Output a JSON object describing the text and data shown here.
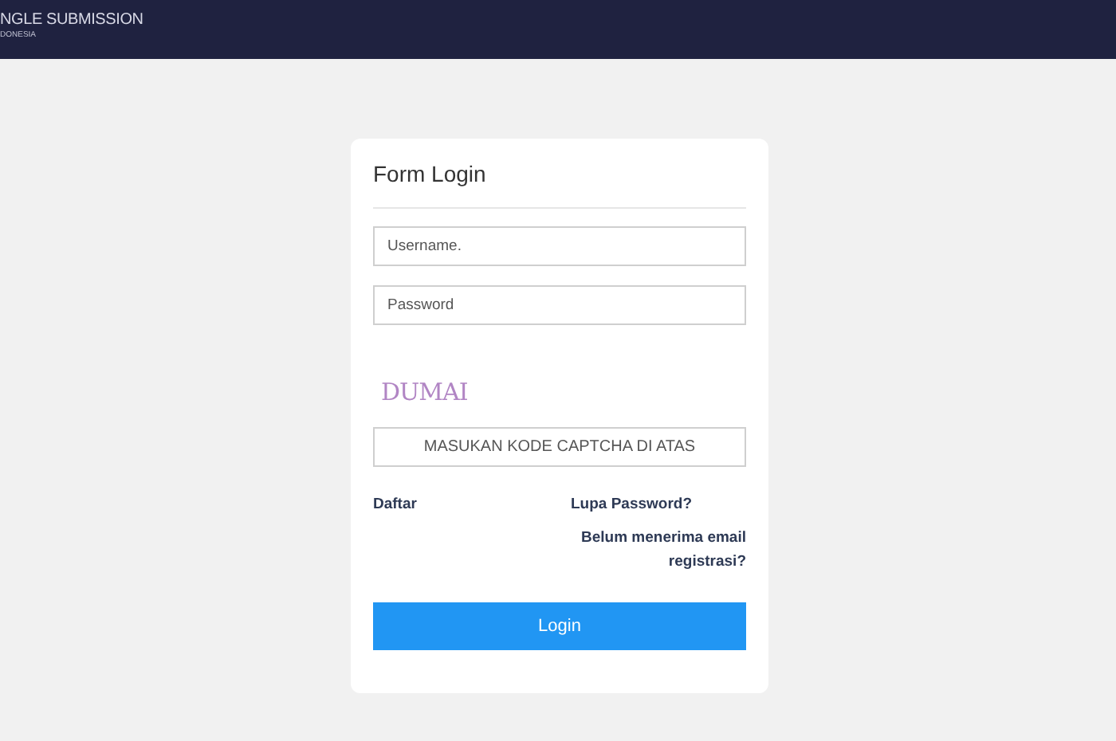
{
  "header": {
    "title": "NGLE SUBMISSION",
    "subtitle": "DONESIA"
  },
  "form": {
    "title": "Form Login",
    "fields": [
      {
        "placeholder": "Username."
      },
      {
        "placeholder": "Password"
      }
    ],
    "captcha": {
      "code": "DUMAI",
      "placeholder": "MASUKAN KODE CAPTCHA DI ATAS"
    },
    "links": {
      "left": "Daftar",
      "right": [
        "Lupa Password?",
        "Belum menerima email registrasi?"
      ]
    },
    "button": "Login"
  }
}
